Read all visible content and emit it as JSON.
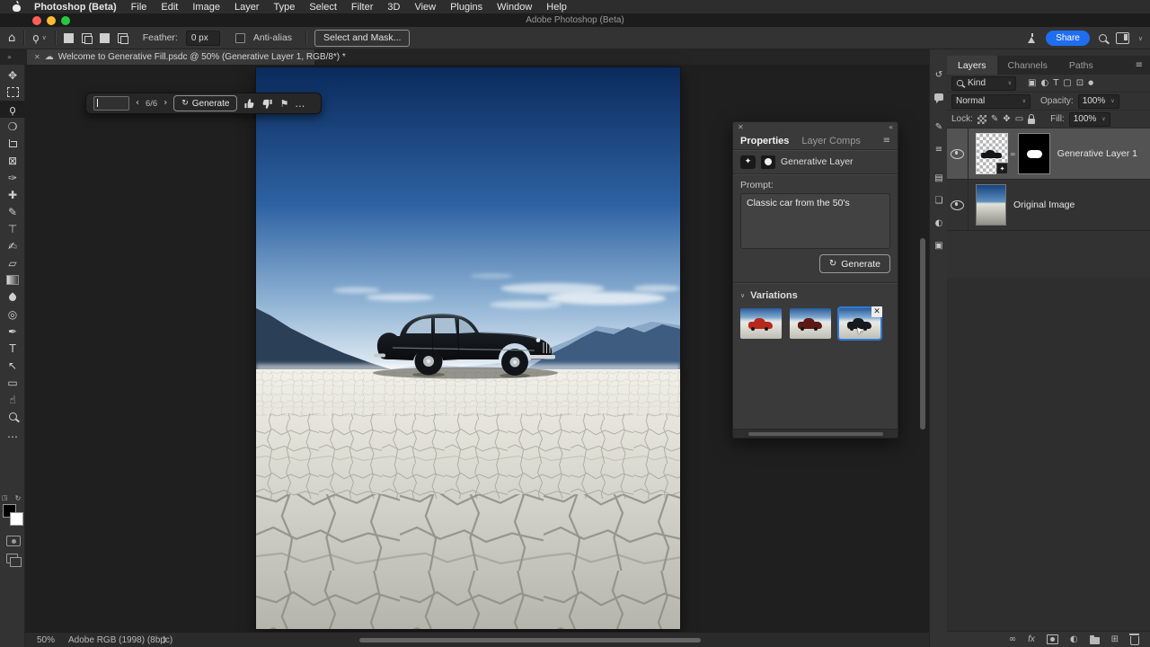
{
  "menubar": {
    "app_name": "Photoshop (Beta)",
    "items": [
      "File",
      "Edit",
      "Image",
      "Layer",
      "Type",
      "Select",
      "Filter",
      "3D",
      "View",
      "Plugins",
      "Window",
      "Help"
    ]
  },
  "titlebar": {
    "title": "Adobe Photoshop (Beta)"
  },
  "options_bar": {
    "feather_label": "Feather:",
    "feather_value": "0 px",
    "antialias_label": "Anti-alias",
    "select_and_mask_label": "Select and Mask...",
    "share_label": "Share"
  },
  "document_tab": {
    "title": "Welcome to Generative Fill.psdc @ 50% (Generative Layer 1, RGB/8*) *"
  },
  "generative_bar": {
    "counter": "6/6",
    "generate_label": "Generate"
  },
  "properties_panel": {
    "tab_properties": "Properties",
    "tab_layer_comps": "Layer Comps",
    "layer_type_label": "Generative Layer",
    "prompt_label": "Prompt:",
    "prompt_value": "Classic car from the 50's",
    "generate_label": "Generate",
    "variations_label": "Variations"
  },
  "layers_panel": {
    "tab_layers": "Layers",
    "tab_channels": "Channels",
    "tab_paths": "Paths",
    "kind_label": "Kind",
    "blend_mode": "Normal",
    "opacity_label": "Opacity:",
    "opacity_value": "100%",
    "lock_label": "Lock:",
    "fill_label": "Fill:",
    "fill_value": "100%",
    "layers": [
      {
        "name": "Generative Layer 1",
        "selected": true
      },
      {
        "name": "Original Image",
        "selected": false
      }
    ]
  },
  "status_bar": {
    "zoom_level": "50%",
    "color_profile": "Adobe RGB (1998) (8bpc)"
  },
  "variation_styles": {
    "red": "background:#b6271c",
    "maroon": "background:#5c1812",
    "black": "background:#16191d"
  },
  "colors": {
    "accent_blue": "#1473e6",
    "selection_border": "#2e7bd9",
    "share_button": "#1f6ef0"
  },
  "icons": {
    "home": "⌂",
    "lasso": "ϙ",
    "chevron_down": "∨",
    "chevron_left": "‹",
    "chevron_right": "›",
    "collapse_left": "«",
    "collapse_right": "»",
    "chevron_small": "❯",
    "close": "✕",
    "cloud": "☁",
    "refresh": "↻",
    "flag": "⚑",
    "ellipsis": "…",
    "hamburger": "≡",
    "sparkle": "✦",
    "move": "✥",
    "quick_select": "❍",
    "frame": "⊠",
    "eyedropper": "✑",
    "healing": "✚",
    "brush": "✎",
    "stamp": "⊤",
    "history_brush": "✍",
    "eraser": "▱",
    "dodge": "◎",
    "pen": "✒",
    "type": "T",
    "path_select": "↖",
    "shape": "▭",
    "hand": "☝",
    "history_panel": "↺",
    "notes_panel": "▤",
    "libraries_panel": "❏",
    "adjustments": "◐",
    "pixel_filter": "▣",
    "smart_filter": "⊡",
    "dot": "●",
    "link": "∞",
    "fx": "fx",
    "plus_box": "⊞"
  }
}
